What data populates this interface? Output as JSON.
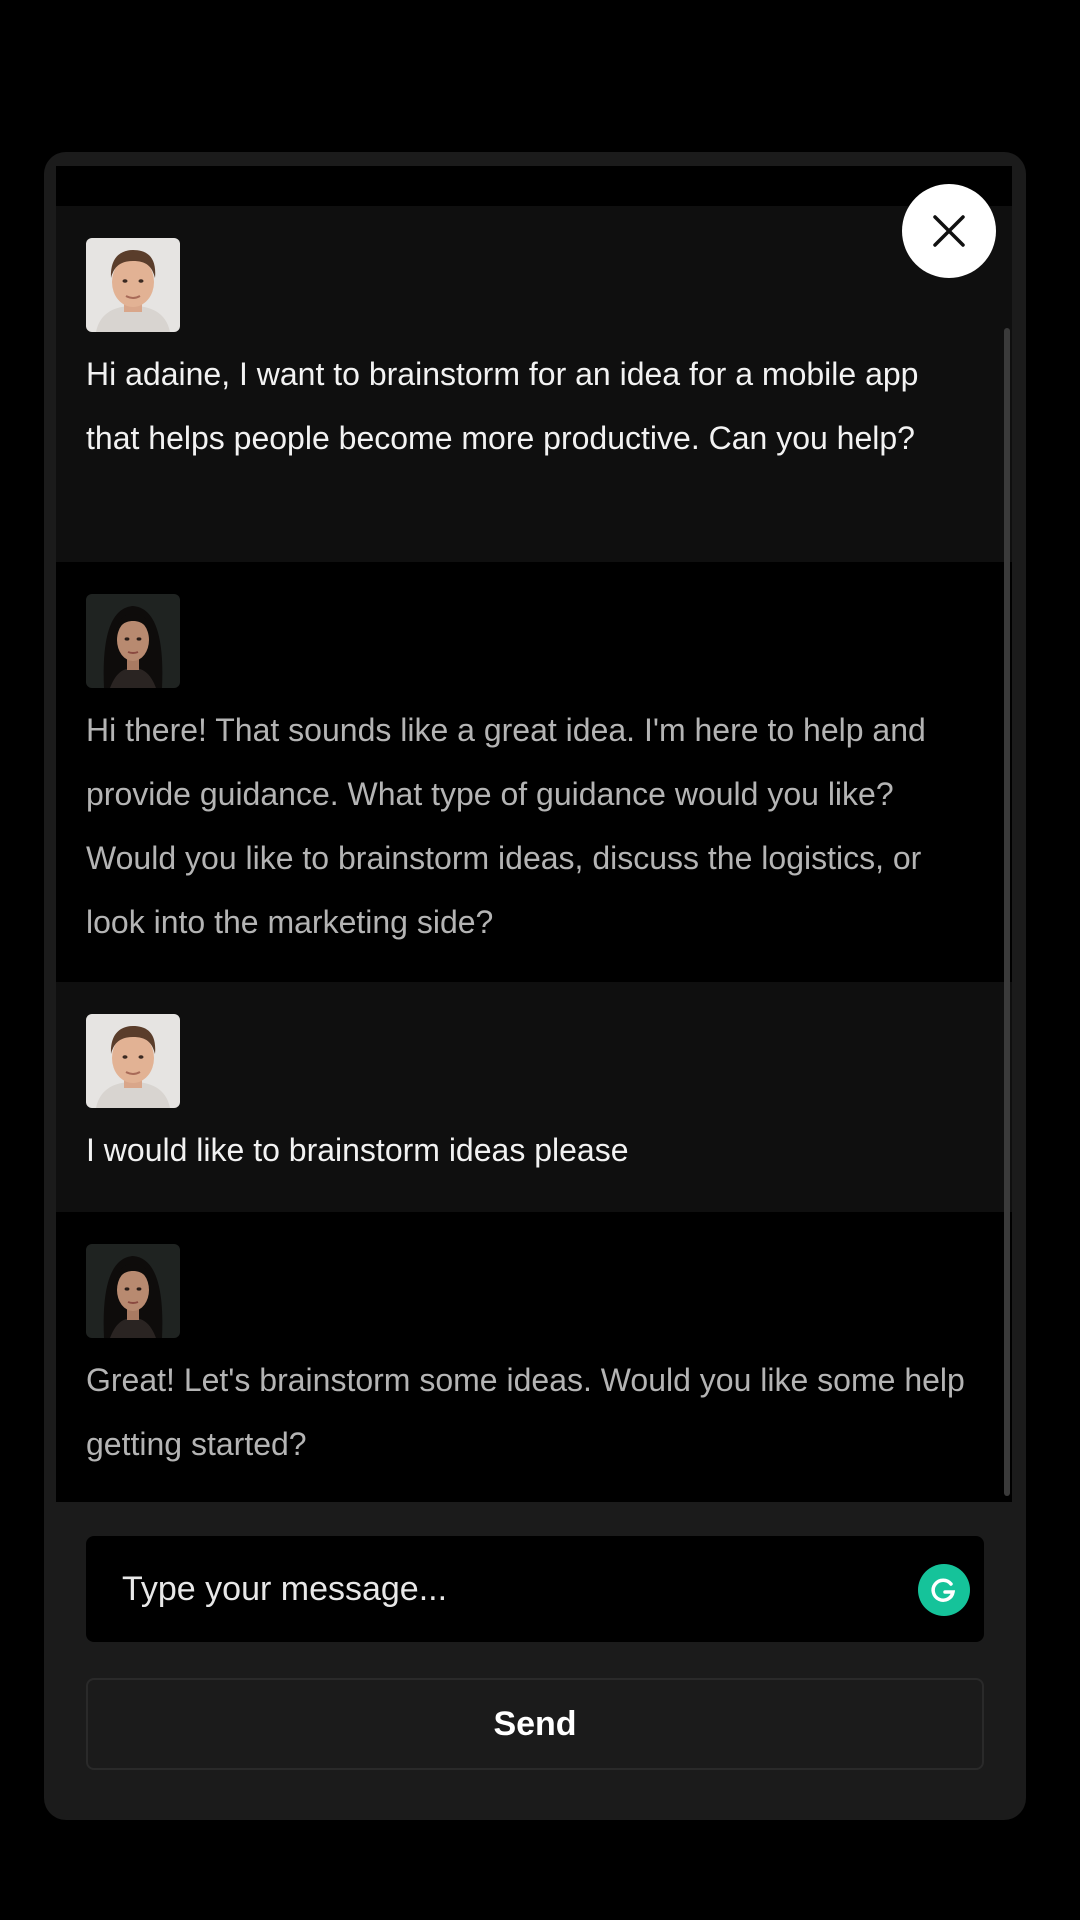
{
  "messages": [
    {
      "role": "user",
      "text": "Hi adaine, I want to brainstorm for an idea for a mobile app that helps people become more productive. Can you help?"
    },
    {
      "role": "assistant",
      "text": "Hi there! That sounds like a great idea. I'm here to help and provide guidance. What type of guidance would you like? Would you like to brainstorm ideas, discuss the logistics, or look into the marketing side?"
    },
    {
      "role": "user",
      "text": "I would like to brainstorm ideas please"
    },
    {
      "role": "assistant",
      "text": "Great! Let's brainstorm some ideas. Would you like some help getting started?"
    }
  ],
  "composer": {
    "placeholder": "Type your message...",
    "send_label": "Send"
  },
  "icons": {
    "close": "close-icon",
    "grammarly": "grammarly-icon"
  },
  "colors": {
    "page_background": "#000000",
    "panel_background": "#1b1b1b",
    "user_message_background": "#0f0f0f",
    "assistant_message_background": "#000000",
    "grammarly_green": "#15c39a"
  }
}
